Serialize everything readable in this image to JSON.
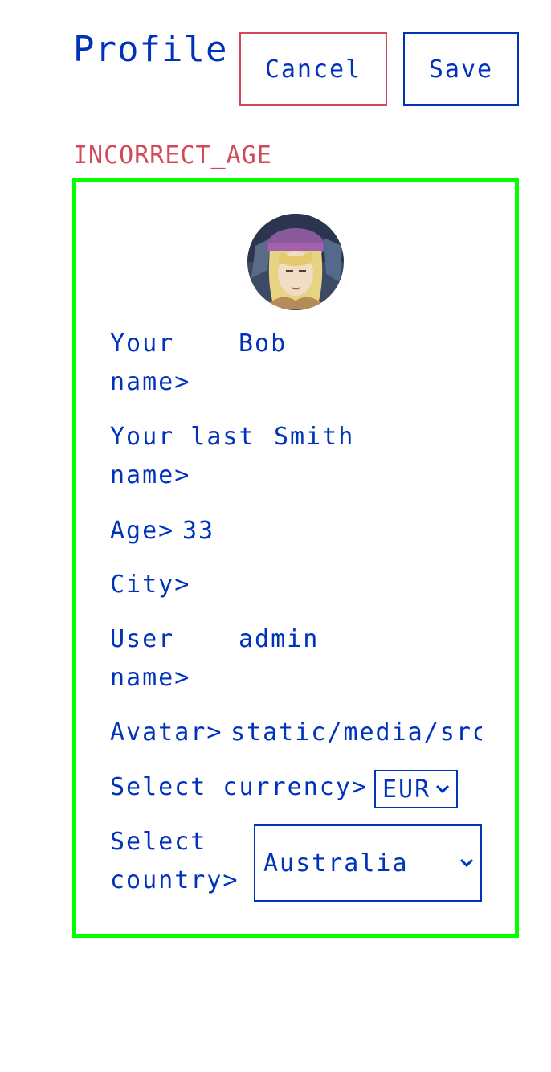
{
  "header": {
    "title": "Profile",
    "cancel_label": "Cancel",
    "save_label": "Save"
  },
  "error": "INCORRECT_AGE",
  "form": {
    "name_label_1": "Your",
    "name_label_2": "name>",
    "name_value": "Bob",
    "lastname_label_1": "Your last",
    "lastname_label_2": "name>",
    "lastname_value": "Smith",
    "age_label": "Age>",
    "age_value": "33",
    "city_label": "City>",
    "city_value": "",
    "username_label_1": "User",
    "username_label_2": "name>",
    "username_value": "admin",
    "avatar_label": "Avatar>",
    "avatar_value": "static/media/src",
    "currency_label": "Select currency>",
    "currency_value": "EUR",
    "country_label_1": "Select",
    "country_label_2": "country>",
    "country_value": "Australia"
  },
  "colors": {
    "accent": "#0033bb",
    "error": "#d04a5a",
    "frame": "#00ff00"
  },
  "icons": [
    "chevron-down-icon",
    "avatar-image"
  ]
}
